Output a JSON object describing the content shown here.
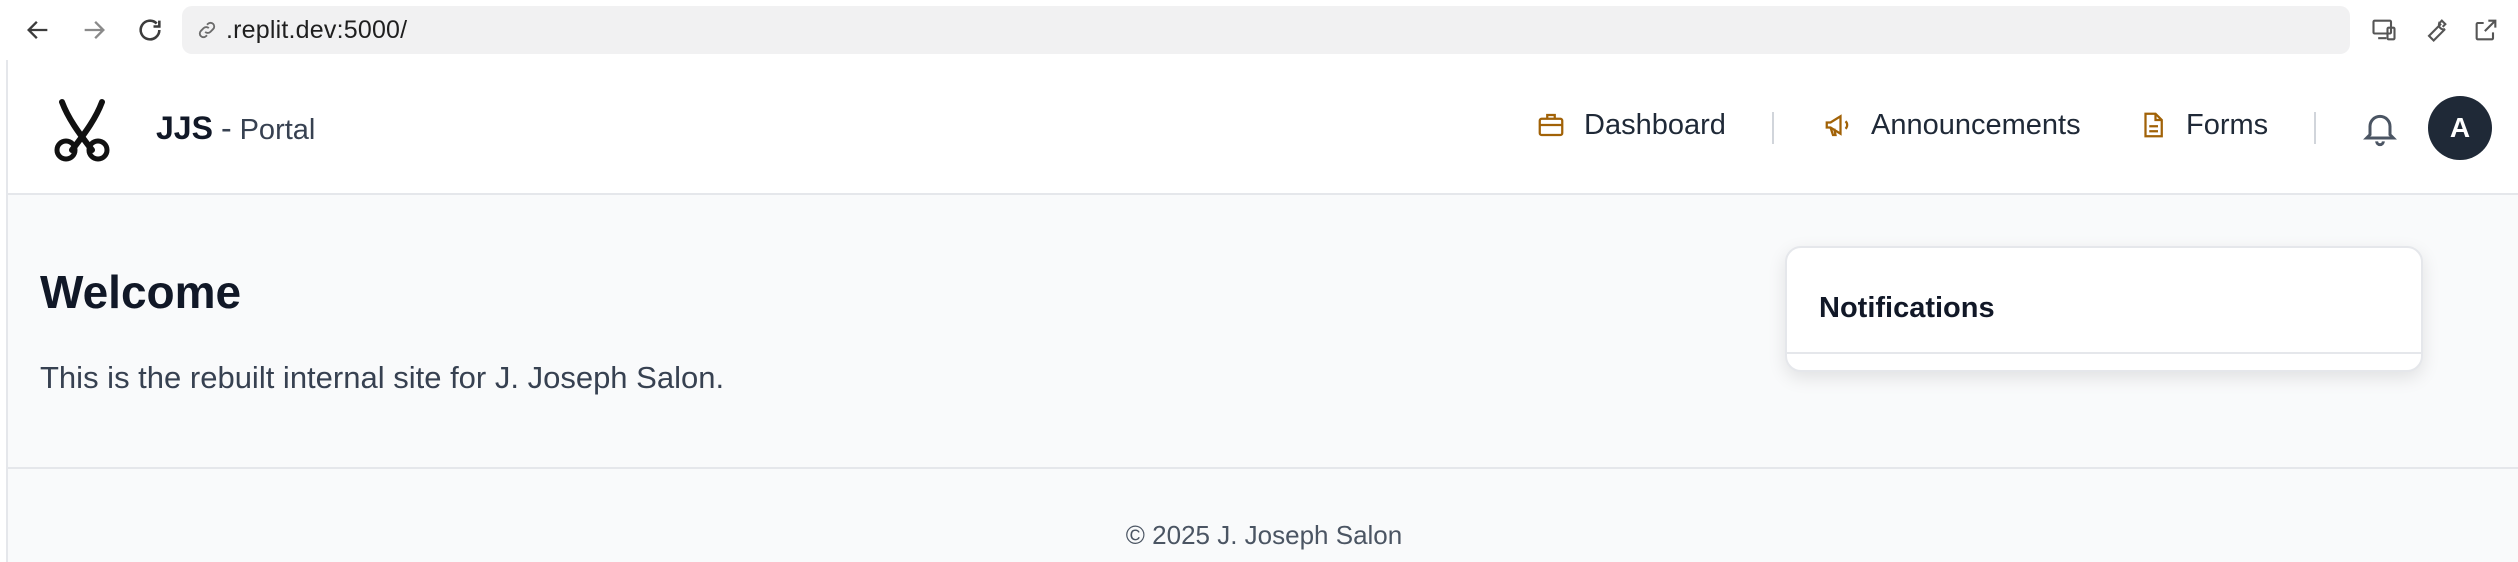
{
  "browser": {
    "url": ".replit.dev:5000/",
    "back_icon": "arrow-left-icon",
    "forward_icon": "arrow-right-icon",
    "reload_icon": "reload-icon",
    "tools": [
      "devices-icon",
      "wrench-icon",
      "open-external-icon"
    ]
  },
  "header": {
    "brand_main": "JJS",
    "brand_sep": "-",
    "brand_sub": "Portal",
    "nav": [
      {
        "label": "Dashboard",
        "icon": "briefcase-icon"
      },
      {
        "label": "Announcements",
        "icon": "megaphone-icon"
      },
      {
        "label": "Forms",
        "icon": "document-icon"
      }
    ],
    "avatar_initial": "A",
    "accent_color": "#a16207"
  },
  "main": {
    "heading": "Welcome",
    "intro": "This is the rebuilt internal site for J. Joseph Salon."
  },
  "footer": {
    "text": "© 2025 J. Joseph Salon"
  },
  "notifications": {
    "title": "Notifications"
  }
}
